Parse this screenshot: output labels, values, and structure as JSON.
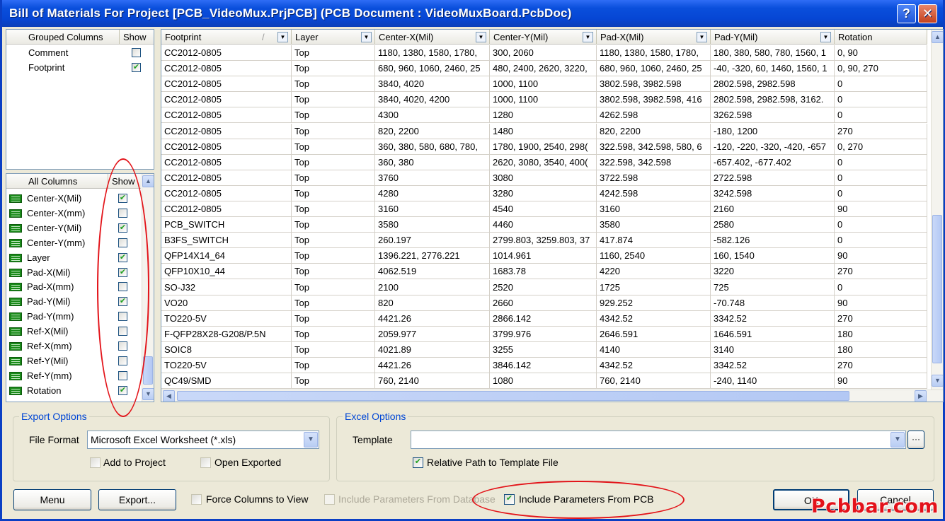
{
  "window": {
    "title": "Bill of Materials For Project [PCB_VideoMux.PrjPCB] (PCB Document : VideoMuxBoard.PcbDoc)",
    "help": "?",
    "close": "✕"
  },
  "grouped": {
    "headers": [
      "Grouped Columns",
      "Show"
    ],
    "rows": [
      {
        "name": "Comment",
        "checked": false
      },
      {
        "name": "Footprint",
        "checked": true
      }
    ]
  },
  "allcols": {
    "headers": [
      "All Columns",
      "Show"
    ],
    "rows": [
      {
        "name": "Center-X(Mil)",
        "checked": true
      },
      {
        "name": "Center-X(mm)",
        "checked": false
      },
      {
        "name": "Center-Y(Mil)",
        "checked": true
      },
      {
        "name": "Center-Y(mm)",
        "checked": false
      },
      {
        "name": "Layer",
        "checked": true
      },
      {
        "name": "Pad-X(Mil)",
        "checked": true
      },
      {
        "name": "Pad-X(mm)",
        "checked": false
      },
      {
        "name": "Pad-Y(Mil)",
        "checked": true
      },
      {
        "name": "Pad-Y(mm)",
        "checked": false
      },
      {
        "name": "Ref-X(Mil)",
        "checked": false
      },
      {
        "name": "Ref-X(mm)",
        "checked": false
      },
      {
        "name": "Ref-Y(Mil)",
        "checked": false
      },
      {
        "name": "Ref-Y(mm)",
        "checked": false
      },
      {
        "name": "Rotation",
        "checked": true
      }
    ]
  },
  "grid": {
    "headers": [
      "Footprint",
      "Layer",
      "Center-X(Mil)",
      "Center-Y(Mil)",
      "Pad-X(Mil)",
      "Pad-Y(Mil)",
      "Rotation"
    ],
    "sort_mark": "/",
    "rows": [
      [
        "CC2012-0805",
        "Top",
        "1180, 1380, 1580, 1780,",
        "300, 2060",
        "1180, 1380, 1580, 1780,",
        "180, 380, 580, 780, 1560, 1",
        "0, 90"
      ],
      [
        "CC2012-0805",
        "Top",
        "680, 960, 1060, 2460, 25",
        "480, 2400, 2620, 3220,",
        "680, 960, 1060, 2460, 25",
        "-40, -320, 60, 1460, 1560, 1",
        "0, 90, 270"
      ],
      [
        "CC2012-0805",
        "Top",
        "3840, 4020",
        "1000, 1100",
        "3802.598, 3982.598",
        "2802.598, 2982.598",
        "0"
      ],
      [
        "CC2012-0805",
        "Top",
        "3840, 4020, 4200",
        "1000, 1100",
        "3802.598, 3982.598, 416",
        "2802.598, 2982.598, 3162.",
        "0"
      ],
      [
        "CC2012-0805",
        "Top",
        "4300",
        "1280",
        "4262.598",
        "3262.598",
        "0"
      ],
      [
        "CC2012-0805",
        "Top",
        "820, 2200",
        "1480",
        "820, 2200",
        "-180, 1200",
        "270"
      ],
      [
        "CC2012-0805",
        "Top",
        "360, 380, 580, 680, 780,",
        "1780, 1900, 2540, 298(",
        "322.598, 342.598, 580, 6",
        "-120, -220, -320, -420, -657",
        "0, 270"
      ],
      [
        "CC2012-0805",
        "Top",
        "360, 380",
        "2620, 3080, 3540, 400(",
        "322.598, 342.598",
        "-657.402, -677.402",
        "0"
      ],
      [
        "CC2012-0805",
        "Top",
        "3760",
        "3080",
        "3722.598",
        "2722.598",
        "0"
      ],
      [
        "CC2012-0805",
        "Top",
        "4280",
        "3280",
        "4242.598",
        "3242.598",
        "0"
      ],
      [
        "CC2012-0805",
        "Top",
        "3160",
        "4540",
        "3160",
        "2160",
        "90"
      ],
      [
        "PCB_SWITCH",
        "Top",
        "3580",
        "4460",
        "3580",
        "2580",
        "0"
      ],
      [
        "B3FS_SWITCH",
        "Top",
        "260.197",
        "2799.803, 3259.803, 37",
        "417.874",
        "-582.126",
        "0"
      ],
      [
        "QFP14X14_64",
        "Top",
        "1396.221, 2776.221",
        "1014.961",
        "1160, 2540",
        "160, 1540",
        "90"
      ],
      [
        "QFP10X10_44",
        "Top",
        "4062.519",
        "1683.78",
        "4220",
        "3220",
        "270"
      ],
      [
        "SO-J32",
        "Top",
        "2100",
        "2520",
        "1725",
        "725",
        "0"
      ],
      [
        "VO20",
        "Top",
        "820",
        "2660",
        "929.252",
        "-70.748",
        "90"
      ],
      [
        "TO220-5V",
        "Top",
        "4421.26",
        "2866.142",
        "4342.52",
        "3342.52",
        "270"
      ],
      [
        "F-QFP28X28-G208/P.5N",
        "Top",
        "2059.977",
        "3799.976",
        "2646.591",
        "1646.591",
        "180"
      ],
      [
        "SOIC8",
        "Top",
        "4021.89",
        "3255",
        "4140",
        "3140",
        "180"
      ],
      [
        "TO220-5V",
        "Top",
        "4421.26",
        "3846.142",
        "4342.52",
        "3342.52",
        "270"
      ],
      [
        "QC49/SMD",
        "Top",
        "760, 2140",
        "1080",
        "760, 2140",
        "-240, 1140",
        "90"
      ]
    ]
  },
  "export": {
    "title": "Export Options",
    "file_format_label": "File Format",
    "file_format_value": "Microsoft Excel Worksheet (*.xls)",
    "add_to_project": "Add to Project",
    "open_exported": "Open Exported"
  },
  "excel": {
    "title": "Excel Options",
    "template_label": "Template",
    "template_value": "",
    "browse": "···",
    "relative_path": "Relative Path to Template File"
  },
  "footer": {
    "menu": "Menu",
    "export": "Export...",
    "force_columns": "Force Columns to View",
    "include_db": "Include Parameters From Database",
    "include_pcb": "Include Parameters From PCB",
    "ok": "OK",
    "cancel": "Cancel"
  },
  "watermark": "Pcbbar.com",
  "colors": {
    "title_bar": "#0a4fdc",
    "accent": "#0046d5",
    "highlight": "#e3141a"
  }
}
